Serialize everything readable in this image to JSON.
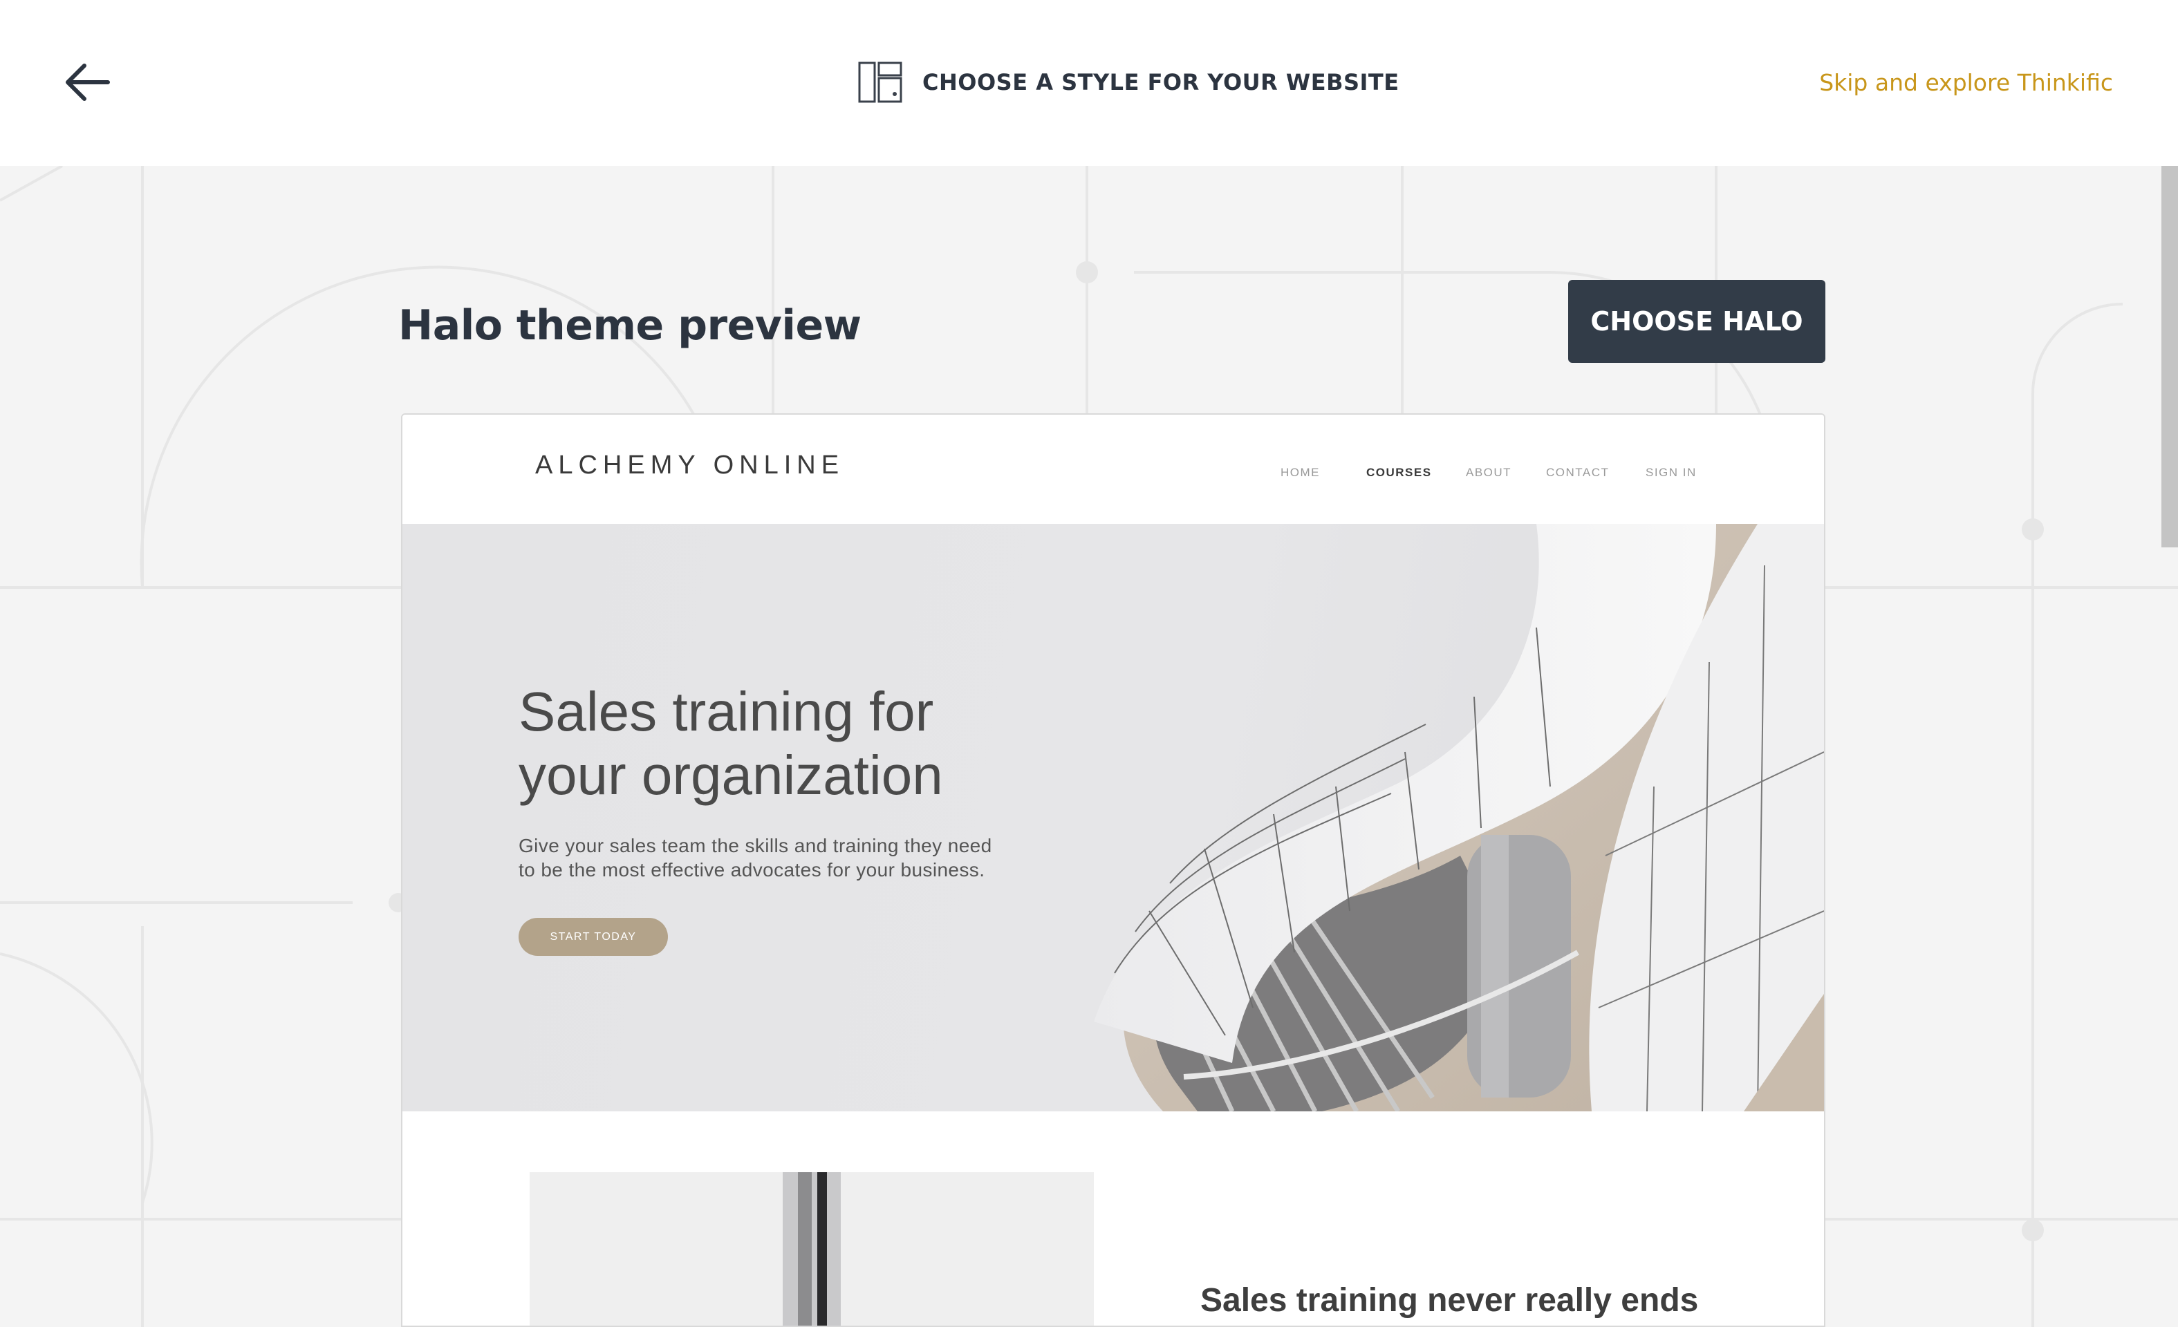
{
  "header": {
    "back_icon": "arrow-left-icon",
    "title_icon": "layout-icon",
    "title": "CHOOSE A STYLE FOR YOUR WEBSITE",
    "skip_link": "Skip and explore Thinkific"
  },
  "preview": {
    "title": "Halo theme preview",
    "choose_button": "CHOOSE HALO"
  },
  "site": {
    "logo": "ALCHEMY ONLINE",
    "nav": [
      "HOME",
      "COURSES",
      "ABOUT",
      "CONTACT",
      "SIGN IN"
    ],
    "active_nav": "COURSES",
    "hero": {
      "title_line1": "Sales training for",
      "title_line2": "your organization",
      "subtitle_line1": "Give your sales team the skills and training they need",
      "subtitle_line2": "to be the most effective advocates for your business.",
      "button": "START TODAY"
    },
    "section_heading": "Sales training never really ends"
  },
  "colors": {
    "accent": "#c8961a",
    "dark_button": "#323c48",
    "hero_button": "#b3a38a",
    "page_bg": "#f4f4f4"
  }
}
